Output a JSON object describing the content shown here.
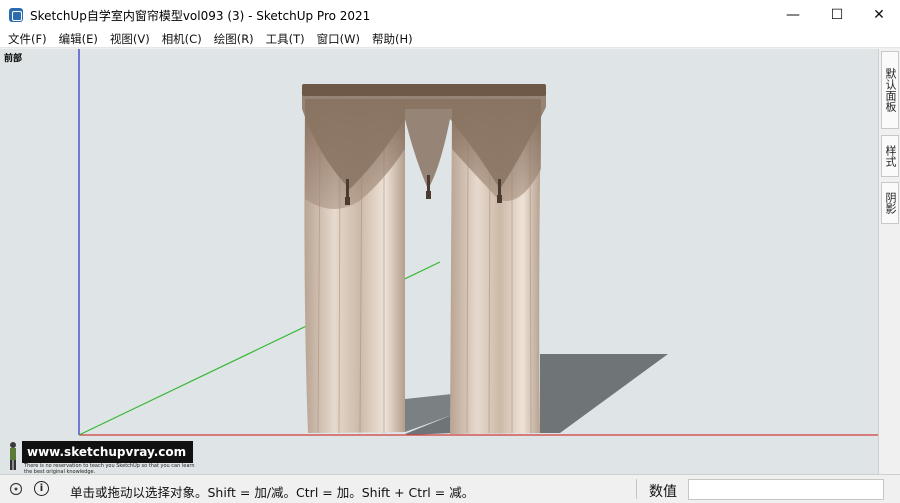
{
  "window": {
    "title": "SketchUp自学室内窗帘模型vol093 (3) - SketchUp Pro 2021",
    "minimize": "—",
    "maximize": "☐",
    "close": "✕"
  },
  "menu": [
    "文件(F)",
    "编辑(E)",
    "视图(V)",
    "相机(C)",
    "绘图(R)",
    "工具(T)",
    "窗口(W)",
    "帮助(H)"
  ],
  "viewport": {
    "scene_label": "前部",
    "colors": {
      "background": "#dfe4e6",
      "axis_blue": "#2f2fc8",
      "axis_red": "#d23a3a",
      "axis_green": "#33b833",
      "curtain": "#c9b8a8",
      "curtain_dark": "#8a7463",
      "shadow": "#6f7476"
    }
  },
  "right_panel": {
    "tabs": [
      "默认面板",
      "样式",
      "阴影"
    ]
  },
  "watermark": {
    "url": "www.sketchupvray.com",
    "small_text": "There is no reservation to teach you SketchUp so that you can learn the best original knowledge."
  },
  "statusbar": {
    "info_icon": "i",
    "message": "单击或拖动以选择对象。Shift = 加/减。Ctrl = 加。Shift + Ctrl = 减。",
    "measurements_label": "数值",
    "measurements_value": ""
  }
}
